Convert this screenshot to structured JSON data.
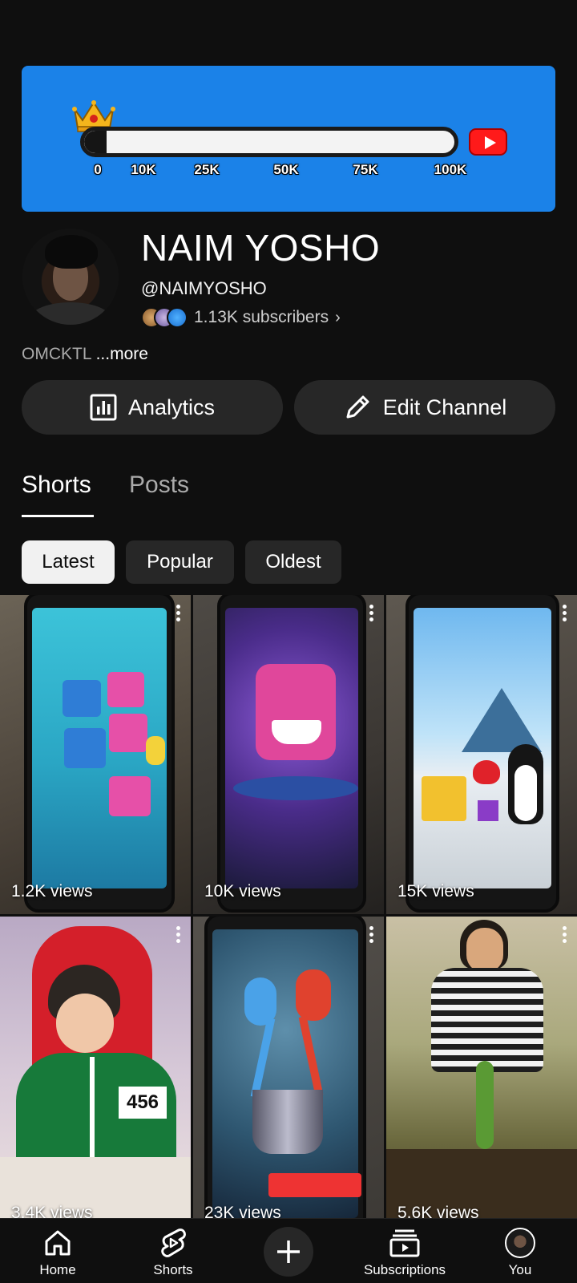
{
  "banner": {
    "progress_ticks": [
      "0",
      "10K",
      "25K",
      "50K",
      "75K",
      "100K"
    ],
    "progress_fill_fraction": 0.06,
    "colors": {
      "background": "#1b82e8",
      "youtube_red": "#ff1a1a"
    }
  },
  "channel": {
    "name": "NAIM YOSHO",
    "handle": "@NAIMYOSHO",
    "subscribers": "1.13K subscribers",
    "chevron": "›",
    "description": "OMCKTL",
    "more": "...more"
  },
  "actions": {
    "analytics_label": "Analytics",
    "edit_label": "Edit Channel"
  },
  "tabs": [
    {
      "label": "Shorts",
      "selected": true
    },
    {
      "label": "Posts",
      "selected": false
    }
  ],
  "chips": [
    {
      "label": "Latest",
      "selected": true
    },
    {
      "label": "Popular",
      "selected": false
    },
    {
      "label": "Oldest",
      "selected": false
    }
  ],
  "shorts": [
    {
      "views": "1.2K views",
      "thumbnail": "phone-cube-monsters"
    },
    {
      "views": "10K views",
      "thumbnail": "phone-pink-monster"
    },
    {
      "views": "15K views",
      "thumbnail": "phone-penguin-heart"
    },
    {
      "views": "3.4K views",
      "thumbnail": "squid-game-player-456"
    },
    {
      "views": "23K views",
      "thumbnail": "phone-toothbrush-monsters"
    },
    {
      "views": "5.6K views",
      "thumbnail": "woman-pea-plant"
    }
  ],
  "nav": {
    "home": "Home",
    "shorts": "Shorts",
    "subscriptions": "Subscriptions",
    "you": "You"
  },
  "icons": {
    "analytics": "bar-chart-icon",
    "edit": "pencil-icon",
    "home": "home-icon",
    "shorts": "shorts-icon",
    "create": "plus-icon",
    "subscriptions": "subscriptions-icon",
    "you": "avatar-icon",
    "more": "kebab-menu-icon"
  }
}
